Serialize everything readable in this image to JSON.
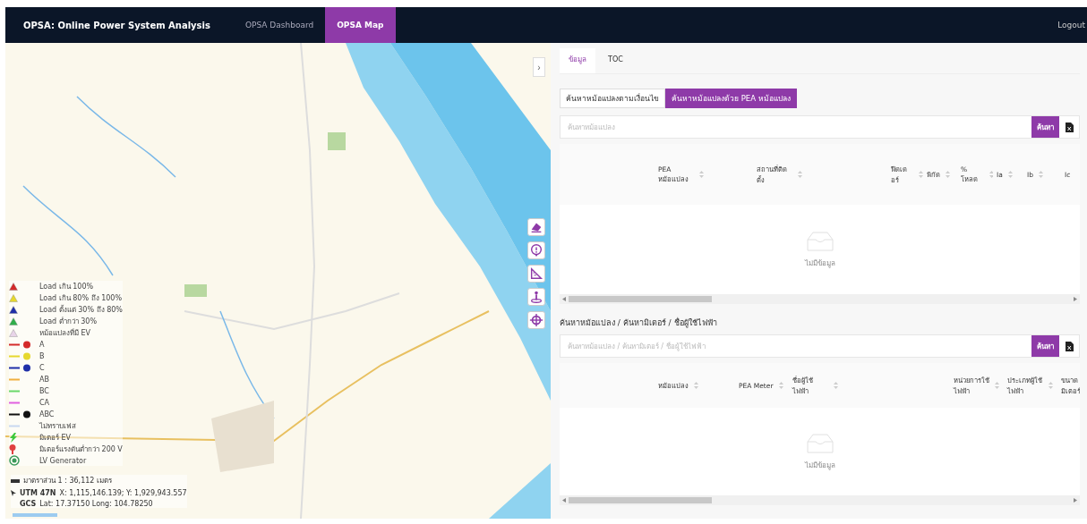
{
  "navbar": {
    "brand": "OPSA: Online Power System Analysis",
    "items": [
      {
        "label": "OPSA Dashboard",
        "selected": false
      },
      {
        "label": "OPSA Map",
        "selected": true
      }
    ],
    "logout": "Logout"
  },
  "map": {
    "collapse_button": "›",
    "legend": [
      {
        "kind": "triangle",
        "color": "#d42a2a",
        "label": "Load เกิน 100%"
      },
      {
        "kind": "triangle",
        "color": "#e6d82e",
        "label": "Load เกิน 80% ถึง 100%"
      },
      {
        "kind": "triangle",
        "color": "#1f2fa8",
        "label": "Load ตั้งแต่ 30% ถึง 80%"
      },
      {
        "kind": "triangle",
        "color": "#2fae4a",
        "label": "Load ต่ำกว่า 30%"
      },
      {
        "kind": "triangle",
        "color": "#e8d4e8",
        "label": "หม้อแปลงที่มี EV"
      },
      {
        "kind": "phase-dot",
        "color": "#d42a2a",
        "label": "A"
      },
      {
        "kind": "phase-dot",
        "color": "#e6d82e",
        "label": "B"
      },
      {
        "kind": "phase-dot",
        "color": "#1f2fa8",
        "label": "C"
      },
      {
        "kind": "phase-line",
        "color": "#f0b040",
        "label": "AB"
      },
      {
        "kind": "phase-line",
        "color": "#6ad86a",
        "label": "BC"
      },
      {
        "kind": "phase-line",
        "color": "#e060e0",
        "label": "CA"
      },
      {
        "kind": "phase-dot",
        "color": "#111111",
        "label": "ABC"
      },
      {
        "kind": "phase-line",
        "color": "#c8d8f0",
        "label": "ไม่ทราบเฟส"
      },
      {
        "kind": "bolt",
        "color": "#3cc83c",
        "label": "มิเตอร์ EV"
      },
      {
        "kind": "pin",
        "color": "#e04040",
        "label": "มิเตอร์แรงดันต่ำกว่า 200 V"
      },
      {
        "kind": "ring",
        "color": "#3a9a5a",
        "label": "LV Generator"
      }
    ],
    "scale": "มาตราส่วน 1 : 36,112 เมตร",
    "utm_label": "UTM 47N",
    "utm_value": "X: 1,115,146.139; Y: 1,929,943.557",
    "gcs_label": "GCS",
    "gcs_value": "Lat: 17.37150 Long: 104.78250"
  },
  "panel": {
    "tabs": [
      {
        "label": "ข้อมูล",
        "selected": true
      },
      {
        "label": "TOC",
        "selected": false
      }
    ],
    "search_modes": [
      {
        "label": "ค้นหาหม้อแปลงตามเงื่อนไข",
        "selected": false
      },
      {
        "label": "ค้นหาหม้อแปลงด้วย PEA หม้อแปลง",
        "selected": true
      }
    ],
    "transformer_search": {
      "placeholder": "ค้นหาหม้อแปลง",
      "button": "ค้นหา",
      "columns": [
        "PEA หม้อแปลง",
        "สถานที่ติดตั้ง",
        "ฟีดเดอร์",
        "พิกัด",
        "% โหลด",
        "Ia",
        "Ib",
        "Ic"
      ],
      "empty": "ไม่มีข้อมูล"
    },
    "meter_search": {
      "title": "ค้นหาหม้อแปลง / ค้นหามิเตอร์ / ชื่อผู้ใช้ไฟฟ้า",
      "placeholder": "ค้นหาหม้อแปลง / ค้นหามิเตอร์ / ชื่อผู้ใช้ไฟฟ้า",
      "button": "ค้นหา",
      "columns": [
        "หม้อแปลง",
        "PEA Meter",
        "ชื่อผู้ใช้ไฟฟ้า",
        "หน่วยการใช้ไฟฟ้า",
        "ประเภทผู้ใช้ไฟฟ้า",
        "ขนาดมิเตอร์"
      ],
      "empty": "ไม่มีข้อมูล"
    }
  }
}
